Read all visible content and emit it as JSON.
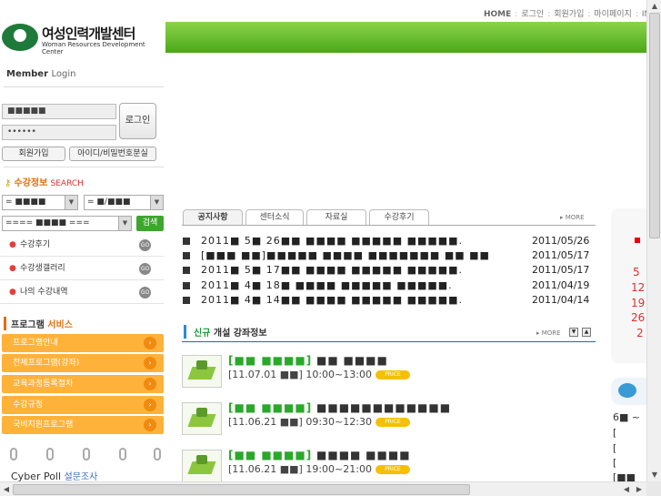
{
  "top_nav": [
    "HOME",
    "로그인",
    "회원가입",
    "마이페이지",
    "IN"
  ],
  "logo": {
    "korean": "여성인력개발센터",
    "english": "Woman Resources Development Center"
  },
  "member": {
    "title": "Member",
    "login": "Login"
  },
  "login": {
    "id_value": "■■■■■",
    "pw_value": "••••••",
    "button": "로그인",
    "join": "회원가입",
    "find": "아이디/비밀번호분실"
  },
  "search": {
    "title_kr": "수강정보",
    "title_en": "SEARCH",
    "select1": "= ■■■■",
    "select2": "= ■/■■■",
    "select3": "==== ■■■■ ===",
    "button": "검색"
  },
  "quick_links": [
    {
      "label": "수강후기"
    },
    {
      "label": "수강생갤러리"
    },
    {
      "label": "나의 수강내역"
    }
  ],
  "go_label": "GO",
  "program": {
    "title1": "프로그램",
    "title2": "서비스",
    "items": [
      "프로그램안내",
      "전체프로그램(강좌)",
      "교육과정등록절차",
      "수강규정",
      "국비지원프로그램"
    ]
  },
  "poll": {
    "title": "Cyber Poll",
    "sub": "설문조사"
  },
  "tabs": [
    "공지사항",
    "센터소식",
    "자료실",
    "수강후기"
  ],
  "more": "MORE",
  "notices": [
    {
      "title": "2011■ 5■ 26■■ ■■■■ ■■■■■ ■■■■■.",
      "date": "2011/05/26"
    },
    {
      "title": "[■■■ ■■]■■■■■ ■■■■ ■■■■■■■ ■■ ■■",
      "date": "2011/05/17"
    },
    {
      "title": "2011■ 5■ 17■■ ■■■■ ■■■■■ ■■■■■.",
      "date": "2011/05/17"
    },
    {
      "title": "2011■ 4■ 18■ ■■■■ ■■■■■ ■■■■■.",
      "date": "2011/04/19"
    },
    {
      "title": "2011■ 4■ 14■■ ■■■■ ■■■■■ ■■■■■.",
      "date": "2011/04/14"
    }
  ],
  "course_section": {
    "title1": "신규",
    "title2": "개설 강좌정보"
  },
  "courses": [
    {
      "tag": "[■■ ■■■■]",
      "name": "■■ ■■■■",
      "schedule": "[11.07.01 ■■] 10:00~13:00"
    },
    {
      "tag": "[■■ ■■■■]",
      "name": "■■■■■■■■■■■■",
      "schedule": "[11.06.21 ■■] 09:30~12:30"
    },
    {
      "tag": "[■■ ■■■■]",
      "name": "■■■■ ■■■■",
      "schedule": "[11.06.21 ■■] 19:00~21:00"
    }
  ],
  "price_label": "PRICE",
  "calendar_days": [
    "5",
    "12",
    "19",
    "26",
    "2"
  ],
  "right_texts": [
    "6■ ~",
    "[",
    "[",
    "[",
    "[■■"
  ]
}
